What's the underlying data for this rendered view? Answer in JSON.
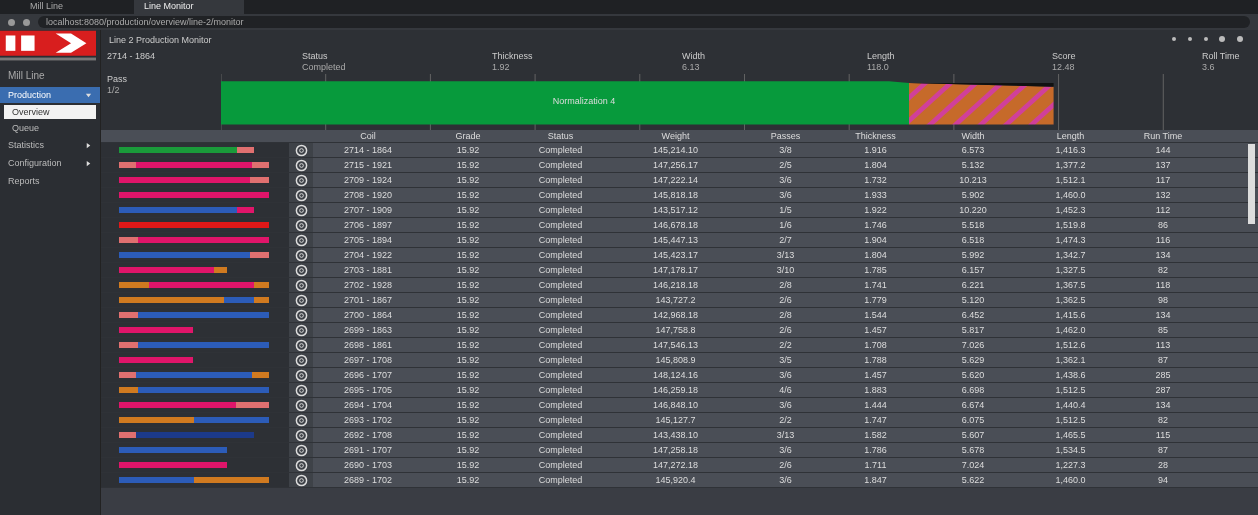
{
  "browser": {
    "tabs": [
      {
        "title": "Mill Line",
        "selected": false
      },
      {
        "title": "Line Monitor",
        "selected": true
      }
    ],
    "url": "localhost:8080/production/overview/line-2/monitor"
  },
  "sidebar": {
    "subtitle": "Mill Line",
    "items": [
      {
        "label": "Production",
        "expanded": true,
        "selected": false,
        "children": [
          {
            "label": "Overview",
            "selected": true
          },
          {
            "label": "Queue",
            "selected": false
          }
        ]
      },
      {
        "label": "Statistics",
        "expanded": false,
        "selected": false
      },
      {
        "label": "Configuration",
        "expanded": false,
        "selected": false
      },
      {
        "label": "Reports",
        "selected": false
      }
    ]
  },
  "header": {
    "title": "Line 2 Production Monitor"
  },
  "summary": {
    "coil": "2714 - 1864",
    "fields": [
      {
        "label": "Status",
        "value": "Completed"
      },
      {
        "label": "Thickness",
        "value": "1.92"
      },
      {
        "label": "Width",
        "value": "6.13"
      },
      {
        "label": "Length",
        "value": "118.0"
      },
      {
        "label": "Score",
        "value": "12.48"
      },
      {
        "label": "Roll Time",
        "value": "3.6"
      }
    ],
    "phase_label": "Pass",
    "phase_value": "1/2",
    "timeline_label": "Normalization 4"
  },
  "table": {
    "columns": [
      "Coil",
      "Grade",
      "Status",
      "Weight",
      "Passes",
      "Thickness",
      "Width",
      "Length",
      "Run Time"
    ],
    "rows": [
      {
        "cells": [
          "2714 - 1864",
          "15.92",
          "Completed",
          "145,214.10",
          "3/8",
          "1.916",
          "6.573",
          "1,416.3",
          "144"
        ],
        "kind": "long",
        "segments": [
          {
            "kind": "main",
            "color": "#1a9a3a"
          },
          {
            "kind": "end",
            "color": "#e07070"
          }
        ]
      },
      {
        "cells": [
          "2715 - 1921",
          "15.92",
          "Completed",
          "147,256.17",
          "2/5",
          "1.804",
          "5.132",
          "1,377.2",
          "137"
        ],
        "kind": "full",
        "segments": [
          {
            "kind": "end",
            "color": "#e07070"
          },
          {
            "kind": "main",
            "color": "#e0156a"
          },
          {
            "kind": "end",
            "color": "#e07070"
          }
        ]
      },
      {
        "cells": [
          "2709 - 1924",
          "15.92",
          "Completed",
          "147,222.14",
          "3/6",
          "1.732",
          "10.213",
          "1,512.1",
          "117"
        ],
        "kind": "full",
        "segments": [
          {
            "kind": "main",
            "color": "#e0156a"
          },
          {
            "kind": "end",
            "color": "#e07070"
          }
        ]
      },
      {
        "cells": [
          "2708 - 1920",
          "15.92",
          "Completed",
          "145,818.18",
          "3/6",
          "1.933",
          "5.902",
          "1,460.0",
          "132"
        ],
        "kind": "full",
        "segments": [
          {
            "kind": "main",
            "color": "#e0156a"
          }
        ]
      },
      {
        "cells": [
          "2707 - 1909",
          "15.92",
          "Completed",
          "143,517.12",
          "1/5",
          "1.922",
          "10.220",
          "1,452.3",
          "112"
        ],
        "kind": "long",
        "segments": [
          {
            "kind": "main",
            "color": "#2c5cb8"
          },
          {
            "kind": "end",
            "color": "#e0156a"
          }
        ]
      },
      {
        "cells": [
          "2706 - 1897",
          "15.92",
          "Completed",
          "146,678.18",
          "1/6",
          "1.746",
          "5.518",
          "1,519.8",
          "86"
        ],
        "kind": "full",
        "segments": [
          {
            "kind": "main",
            "color": "#e01818"
          }
        ]
      },
      {
        "cells": [
          "2705 - 1894",
          "15.92",
          "Completed",
          "145,447.13",
          "2/7",
          "1.904",
          "6.518",
          "1,474.3",
          "116"
        ],
        "kind": "full",
        "segments": [
          {
            "kind": "end",
            "color": "#e07070"
          },
          {
            "kind": "main",
            "color": "#e0156a"
          }
        ]
      },
      {
        "cells": [
          "2704 - 1922",
          "15.92",
          "Completed",
          "145,423.17",
          "3/13",
          "1.804",
          "5.992",
          "1,342.7",
          "134"
        ],
        "kind": "full",
        "segments": [
          {
            "kind": "main",
            "color": "#2c5cb8"
          },
          {
            "kind": "end",
            "color": "#e07070"
          }
        ]
      },
      {
        "cells": [
          "2703 - 1881",
          "15.92",
          "Completed",
          "147,178.17",
          "3/10",
          "1.785",
          "6.157",
          "1,327.5",
          "82"
        ],
        "kind": "medium",
        "segments": [
          {
            "kind": "main",
            "color": "#e0156a"
          },
          {
            "kind": "end",
            "color": "#d07a20"
          }
        ]
      },
      {
        "cells": [
          "2702 - 1928",
          "15.92",
          "Completed",
          "146,218.18",
          "2/8",
          "1.741",
          "6.221",
          "1,367.5",
          "118"
        ],
        "kind": "full",
        "segments": [
          {
            "kind": "mid",
            "color": "#d07a20"
          },
          {
            "kind": "main",
            "color": "#e0156a"
          },
          {
            "kind": "end",
            "color": "#d07a20"
          }
        ]
      },
      {
        "cells": [
          "2701 - 1867",
          "15.92",
          "Completed",
          "143,727.2",
          "2/6",
          "1.779",
          "5.120",
          "1,362.5",
          "98"
        ],
        "kind": "full",
        "segments": [
          {
            "kind": "main",
            "color": "#d07a20"
          },
          {
            "kind": "mid",
            "color": "#2c5cb8"
          },
          {
            "kind": "end",
            "color": "#d07a20"
          }
        ]
      },
      {
        "cells": [
          "2700 - 1864",
          "15.92",
          "Completed",
          "142,968.18",
          "2/8",
          "1.544",
          "6.452",
          "1,415.6",
          "134"
        ],
        "kind": "full",
        "segments": [
          {
            "kind": "end",
            "color": "#e07070"
          },
          {
            "kind": "main",
            "color": "#2c5cb8"
          }
        ]
      },
      {
        "cells": [
          "2699 - 1863",
          "15.92",
          "Completed",
          "147,758.8",
          "2/6",
          "1.457",
          "5.817",
          "1,462.0",
          "85"
        ],
        "kind": "half",
        "segments": [
          {
            "kind": "main",
            "color": "#e0156a"
          }
        ]
      },
      {
        "cells": [
          "2698 - 1861",
          "15.92",
          "Completed",
          "147,546.13",
          "2/2",
          "1.708",
          "7.026",
          "1,512.6",
          "113"
        ],
        "kind": "full",
        "segments": [
          {
            "kind": "end",
            "color": "#e07070"
          },
          {
            "kind": "main",
            "color": "#2c5cb8"
          }
        ]
      },
      {
        "cells": [
          "2697 - 1708",
          "15.92",
          "Completed",
          "145,808.9",
          "3/5",
          "1.788",
          "5.629",
          "1,362.1",
          "87"
        ],
        "kind": "half",
        "segments": [
          {
            "kind": "main",
            "color": "#e0156a"
          }
        ]
      },
      {
        "cells": [
          "2696 - 1707",
          "15.92",
          "Completed",
          "148,124.16",
          "3/6",
          "1.457",
          "5.620",
          "1,438.6",
          "285"
        ],
        "kind": "full",
        "segments": [
          {
            "kind": "end",
            "color": "#e07070"
          },
          {
            "kind": "main",
            "color": "#2c5cb8"
          },
          {
            "kind": "end",
            "color": "#d07a20"
          }
        ]
      },
      {
        "cells": [
          "2695 - 1705",
          "15.92",
          "Completed",
          "146,259.18",
          "4/6",
          "1.883",
          "6.698",
          "1,512.5",
          "287"
        ],
        "kind": "full",
        "segments": [
          {
            "kind": "end",
            "color": "#d07a20"
          },
          {
            "kind": "main",
            "color": "#2c5cb8"
          }
        ]
      },
      {
        "cells": [
          "2694 - 1704",
          "15.92",
          "Completed",
          "146,848.10",
          "3/6",
          "1.444",
          "6.674",
          "1,440.4",
          "134"
        ],
        "kind": "full",
        "segments": [
          {
            "kind": "main",
            "color": "#e0156a"
          },
          {
            "kind": "mid",
            "color": "#e07070"
          }
        ]
      },
      {
        "cells": [
          "2693 - 1702",
          "15.92",
          "Completed",
          "145,127.7",
          "2/2",
          "1.747",
          "6.075",
          "1,512.5",
          "82"
        ],
        "kind": "full",
        "segments": [
          {
            "kind": "main",
            "color": "#d07a20"
          },
          {
            "kind": "main",
            "color": "#2c5cb8"
          }
        ]
      },
      {
        "cells": [
          "2692 - 1708",
          "15.92",
          "Completed",
          "143,438.10",
          "3/13",
          "1.582",
          "5.607",
          "1,465.5",
          "115"
        ],
        "kind": "long",
        "segments": [
          {
            "kind": "end",
            "color": "#e07070"
          },
          {
            "kind": "main",
            "color": "#1c3a8a"
          }
        ]
      },
      {
        "cells": [
          "2691 - 1707",
          "15.92",
          "Completed",
          "147,258.18",
          "3/6",
          "1.786",
          "5.678",
          "1,534.5",
          "87"
        ],
        "kind": "medium",
        "segments": [
          {
            "kind": "main",
            "color": "#2c5cb8"
          }
        ]
      },
      {
        "cells": [
          "2690 - 1703",
          "15.92",
          "Completed",
          "147,272.18",
          "2/6",
          "1.711",
          "7.024",
          "1,227.3",
          "28"
        ],
        "kind": "medium",
        "segments": [
          {
            "kind": "main",
            "color": "#e0156a"
          }
        ]
      },
      {
        "cells": [
          "2689 - 1702",
          "15.92",
          "Completed",
          "145,920.4",
          "3/6",
          "1.847",
          "5.622",
          "1,460.0",
          "94"
        ],
        "kind": "full",
        "segments": [
          {
            "kind": "main",
            "color": "#2c5cb8"
          },
          {
            "kind": "main",
            "color": "#d07a20"
          }
        ]
      }
    ]
  }
}
